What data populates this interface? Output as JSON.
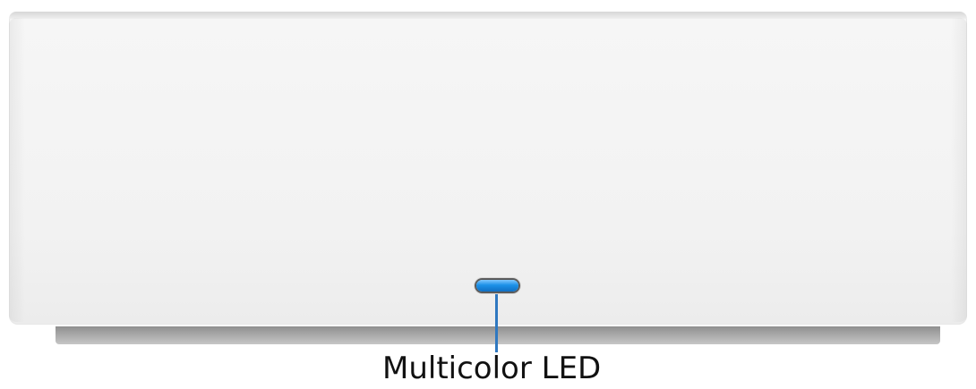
{
  "callout": {
    "label": "Multicolor LED"
  },
  "colors": {
    "led": "#1c91e8",
    "leader_line": "#2f78c0",
    "device_body": "#f2f2f2"
  }
}
